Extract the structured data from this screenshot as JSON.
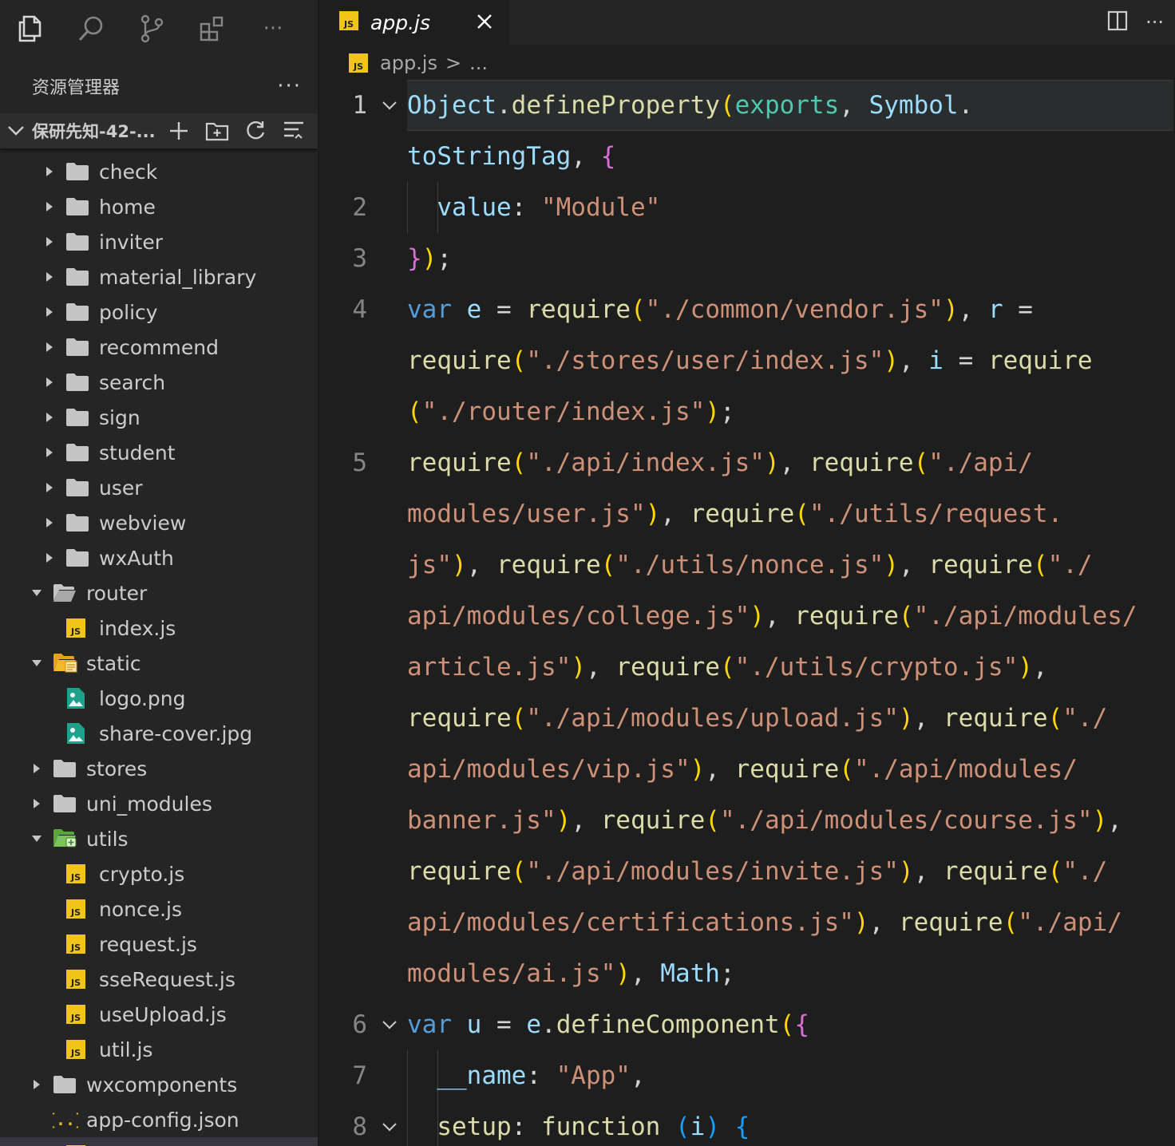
{
  "sidebar": {
    "title": "资源管理器",
    "more": "···",
    "folder_name": "保研先知-42-...",
    "items": [
      {
        "label": "check"
      },
      {
        "label": "home"
      },
      {
        "label": "inviter"
      },
      {
        "label": "material_library"
      },
      {
        "label": "policy"
      },
      {
        "label": "recommend"
      },
      {
        "label": "search"
      },
      {
        "label": "sign"
      },
      {
        "label": "student"
      },
      {
        "label": "user"
      },
      {
        "label": "webview"
      },
      {
        "label": "wxAuth"
      },
      {
        "label": "router"
      },
      {
        "label": "index.js"
      },
      {
        "label": "static"
      },
      {
        "label": "logo.png"
      },
      {
        "label": "share-cover.jpg"
      },
      {
        "label": "stores"
      },
      {
        "label": "uni_modules"
      },
      {
        "label": "utils"
      },
      {
        "label": "crypto.js"
      },
      {
        "label": "nonce.js"
      },
      {
        "label": "request.js"
      },
      {
        "label": "sseRequest.js"
      },
      {
        "label": "useUpload.js"
      },
      {
        "label": "util.js"
      },
      {
        "label": "wxcomponents"
      },
      {
        "label": "app-config.json"
      }
    ]
  },
  "activity_bar": {
    "more": "···"
  },
  "tab": {
    "label": "app.js",
    "icon_text": "JS"
  },
  "breadcrumb": {
    "file": "app.js",
    "sep": ">",
    "rest": "..."
  },
  "editor_actions": {
    "more": "···"
  },
  "code": {
    "lines": [
      "1",
      "2",
      "3",
      "4",
      "5",
      "6",
      "7",
      "8"
    ],
    "hover_dots": "···"
  }
}
